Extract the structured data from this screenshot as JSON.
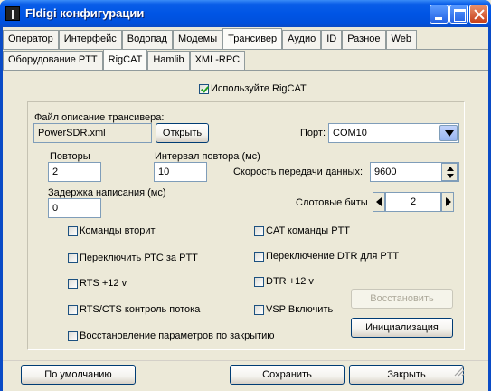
{
  "window": {
    "title": "Fldigi конфигурации"
  },
  "tabs_row1": [
    "Оператор",
    "Интерфейс",
    "Водопад",
    "Модемы",
    "Трансивер",
    "Аудио",
    "ID",
    "Разное",
    "Web"
  ],
  "tabs_row1_active": 4,
  "tabs_row2": [
    "Оборудование PTT",
    "RigCAT",
    "Hamlib",
    "XML-RPC"
  ],
  "tabs_row2_active": 1,
  "rigcat": {
    "use_label": "Используйте RigCAT",
    "use_checked": true,
    "file_label": "Файл описание трансивера:",
    "file_value": "PowerSDR.xml",
    "open_button": "Открыть",
    "port_label": "Порт:",
    "port_value": "COM10",
    "retries_label": "Повторы",
    "retries_value": "2",
    "retry_interval_label": "Интервал повтора (мс)",
    "retry_interval_value": "10",
    "baud_label": "Скорость передачи данных:",
    "baud_value": "9600",
    "write_delay_label": "Задержка написания (мс)",
    "write_delay_value": "0",
    "stop_bits_label": "Слотовые биты",
    "stop_bits_value": "2",
    "checkboxes_left": [
      {
        "label": "Команды вторит",
        "checked": false
      },
      {
        "label": "Переключить РТС за PTT",
        "checked": false
      },
      {
        "label": "RTS +12 v",
        "checked": false
      },
      {
        "label": "RTS/CTS контроль потока",
        "checked": false
      },
      {
        "label": "Восстановление параметров по закрытию",
        "checked": false
      }
    ],
    "checkboxes_right": [
      {
        "label": "CAT команды PTT",
        "checked": false
      },
      {
        "label": "Переключение DTR для PTT",
        "checked": false
      },
      {
        "label": "DTR +12 v",
        "checked": false
      },
      {
        "label": "VSP Включить",
        "checked": false
      }
    ],
    "restore_button": "Восстановить",
    "init_button": "Инициализация"
  },
  "footer": {
    "defaults_button": "По умолчанию",
    "save_button": "Сохранить",
    "close_button": "Закрыть"
  }
}
